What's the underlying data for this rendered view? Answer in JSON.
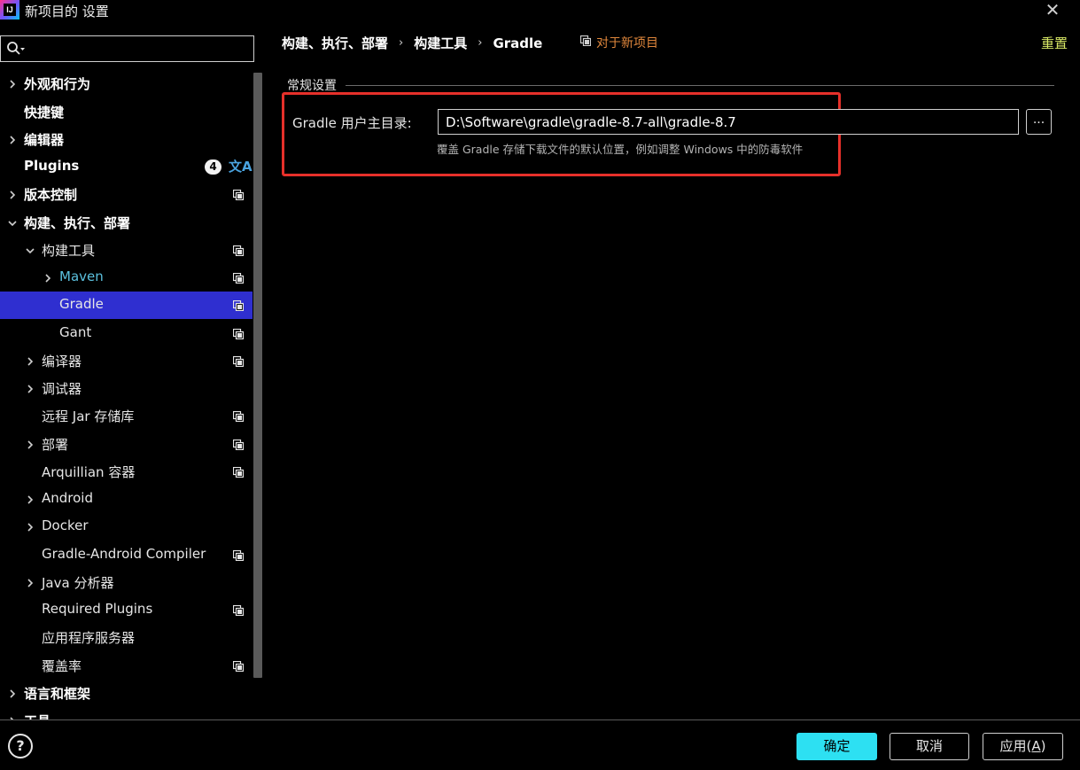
{
  "window": {
    "title": "新项目的 设置",
    "logo_text": "IJ"
  },
  "search": {
    "value": "",
    "placeholder": ""
  },
  "sidebar": {
    "items": [
      {
        "label": "外观和行为",
        "expandable": true,
        "expanded": false,
        "bold": true
      },
      {
        "label": "快捷键",
        "expandable": false,
        "bold": true
      },
      {
        "label": "编辑器",
        "expandable": true,
        "expanded": false,
        "bold": true
      },
      {
        "label": "Plugins",
        "expandable": false,
        "bold": true,
        "badge": "4",
        "translate_icon": "文A"
      },
      {
        "label": "版本控制",
        "expandable": true,
        "expanded": false,
        "bold": true,
        "project_icon": true
      },
      {
        "label": "构建、执行、部署",
        "expandable": true,
        "expanded": true,
        "bold": true
      },
      {
        "label": "构建工具",
        "expandable": true,
        "expanded": true,
        "project_icon": true
      },
      {
        "label": "Maven",
        "expandable": true,
        "expanded": false,
        "project_icon": true,
        "color": "#5bc0de"
      },
      {
        "label": "Gradle",
        "expandable": false,
        "project_icon": true,
        "selected": true
      },
      {
        "label": "Gant",
        "expandable": false,
        "project_icon": true
      },
      {
        "label": "编译器",
        "expandable": true,
        "expanded": false,
        "project_icon": true
      },
      {
        "label": "调试器",
        "expandable": true,
        "expanded": false
      },
      {
        "label": "远程 Jar 存储库",
        "expandable": false,
        "project_icon": true
      },
      {
        "label": "部署",
        "expandable": true,
        "expanded": false,
        "project_icon": true
      },
      {
        "label": "Arquillian 容器",
        "expandable": false,
        "project_icon": true
      },
      {
        "label": "Android",
        "expandable": true,
        "expanded": false
      },
      {
        "label": "Docker",
        "expandable": true,
        "expanded": false
      },
      {
        "label": "Gradle-Android Compiler",
        "expandable": false,
        "project_icon": true
      },
      {
        "label": "Java 分析器",
        "expandable": true,
        "expanded": false
      },
      {
        "label": "Required Plugins",
        "expandable": false,
        "project_icon": true
      },
      {
        "label": "应用程序服务器",
        "expandable": false
      },
      {
        "label": "覆盖率",
        "expandable": false,
        "project_icon": true
      },
      {
        "label": "语言和框架",
        "expandable": true,
        "expanded": false,
        "bold": true
      },
      {
        "label": "工具",
        "expandable": true,
        "expanded": false,
        "bold": true
      }
    ]
  },
  "breadcrumb": [
    "构建、执行、部署",
    "构建工具",
    "Gradle"
  ],
  "header": {
    "for_new_project": "对于新项目",
    "reset": "重置"
  },
  "general": {
    "section_title": "常规设置",
    "field_label": "Gradle 用户主目录:",
    "path_value": "D:\\Software\\gradle\\gradle-8.7-all\\gradle-8.7",
    "browse_label": "...",
    "hint": "覆盖 Gradle 存储下载文件的默认位置，例如调整 Windows 中的防毒软件"
  },
  "footer": {
    "help": "?",
    "ok": "确定",
    "cancel": "取消",
    "apply": "应用(A)",
    "apply_prefix": "应用(",
    "apply_mnemonic": "A",
    "apply_suffix": ")"
  },
  "colors": {
    "background": "#000000",
    "selection": "#2f2fd0",
    "accent_cyan": "#2de0f2",
    "link_orange": "#e0873c",
    "reset_yellow": "#d8e866",
    "highlight_red": "#e6302a",
    "maven_blue": "#5bc0de"
  }
}
